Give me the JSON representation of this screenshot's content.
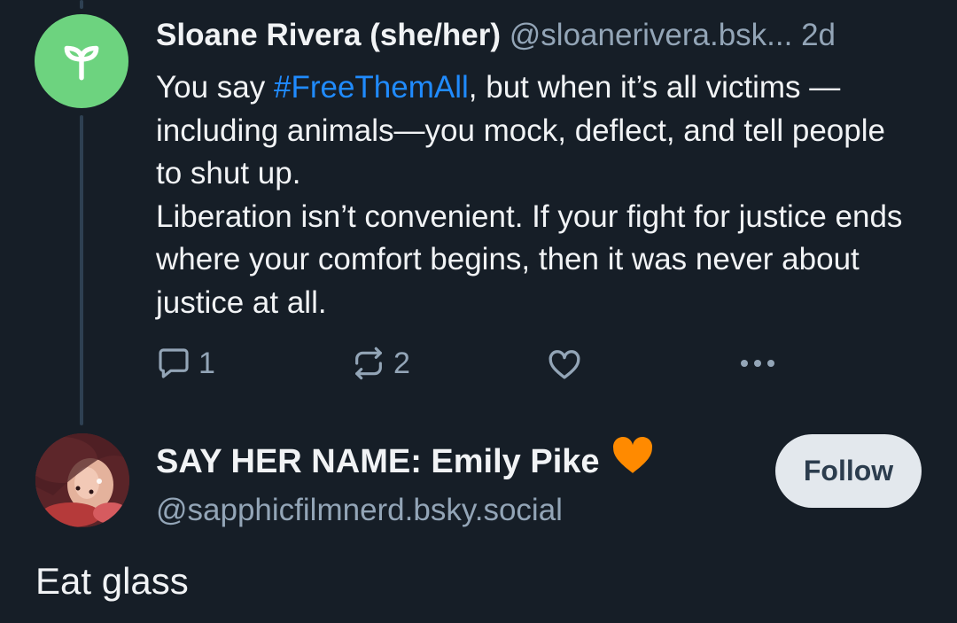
{
  "colors": {
    "background": "#161e27",
    "text": "#f1f3f5",
    "muted": "#93a5b7",
    "hashtag": "#208bfe",
    "sprout_avatar_bg": "#6dd37f",
    "follow_bg": "#e3e8ed",
    "heart_emoji": "#ff8a00"
  },
  "post1": {
    "avatar_icon": "sprout-icon",
    "author_name": "Sloane Rivera (she/her)",
    "author_handle": "@sloanerivera.bsk...",
    "timestamp": "2d",
    "text_before_hashtag": "You say ",
    "hashtag": "#FreeThemAll",
    "text_after_hashtag": ", but when it’s all victims —including animals—you mock, deflect, and tell people to shut up.",
    "paragraph2": "Liberation isn’t convenient. If your fight for justice ends where your comfort begins, then it was never about justice at all.",
    "actions": {
      "reply_icon": "reply-icon",
      "reply_count": "1",
      "repost_icon": "repost-icon",
      "repost_count": "2",
      "like_icon": "heart-icon",
      "more_icon": "more-icon"
    }
  },
  "post2": {
    "author_name": "SAY HER NAME: Emily Pike",
    "name_emoji": "orange-heart-emoji",
    "author_handle": "@sapphicfilmnerd.bsky.social",
    "follow_label": "Follow",
    "text": "Eat glass"
  }
}
